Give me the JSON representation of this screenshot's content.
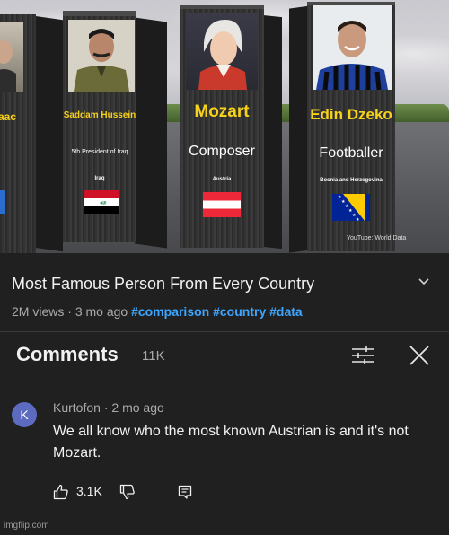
{
  "video": {
    "cards": [
      {
        "name": "aac",
        "role": "",
        "country": ""
      },
      {
        "name": "Saddam Hussein",
        "role": "5th President of Iraq",
        "country": "Iraq"
      },
      {
        "name": "Mozart",
        "role": "Composer",
        "country": "Austria"
      },
      {
        "name": "Edin Dzeko",
        "role": "Footballer",
        "country": "Bosnia and Herzegovina"
      }
    ],
    "watermark": "YouTube: World Data"
  },
  "info": {
    "title": "Most Famous Person From Every Country",
    "views": "2M views",
    "age": "3 mo ago",
    "separator": "·",
    "tags": [
      "#comparison",
      "#country",
      "#data"
    ]
  },
  "comments": {
    "title": "Comments",
    "count": "11K",
    "items": [
      {
        "avatar_letter": "K",
        "avatar_color": "#5c6bc0",
        "author": "Kurtofon",
        "age": "2 mo ago",
        "text": "We all know who the most known Austrian is and it's not Mozart.",
        "likes": "3.1K"
      }
    ]
  },
  "icons": {
    "expand": "chevron-down-icon",
    "filter": "sliders-icon",
    "close": "close-icon",
    "like": "thumbs-up-icon",
    "dislike": "thumbs-down-icon",
    "reply": "reply-icon"
  },
  "colors": {
    "background": "#202020",
    "hashtag": "#3ea6ff",
    "name_yellow": "#f6d21b"
  },
  "footer": {
    "watermark": "imgflip.com"
  }
}
